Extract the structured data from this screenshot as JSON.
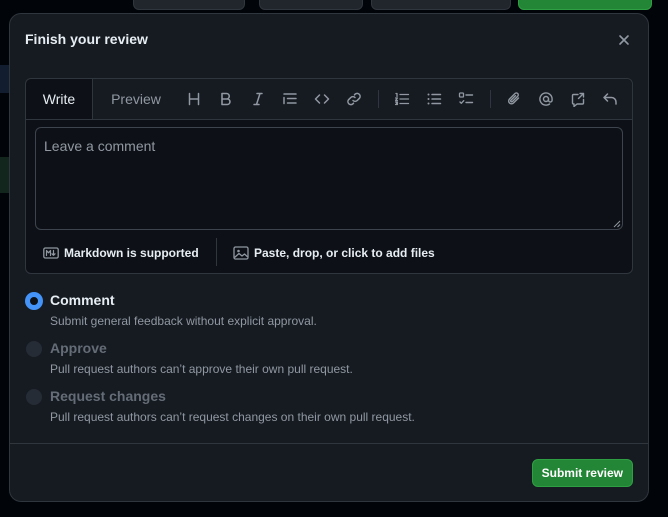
{
  "dialog": {
    "title": "Finish your review"
  },
  "editor": {
    "tabs": [
      {
        "label": "Write",
        "active": true
      },
      {
        "label": "Preview",
        "active": false
      }
    ],
    "toolbar_icons": [
      "heading-icon",
      "bold-icon",
      "italic-icon",
      "quote-icon",
      "code-icon",
      "link-icon",
      "numbered-list-icon",
      "unordered-list-icon",
      "task-list-icon",
      "attach-icon",
      "mention-icon",
      "reference-icon",
      "undo-icon"
    ],
    "comment": {
      "value": "",
      "placeholder": "Leave a comment"
    },
    "footer": {
      "markdown_label": "Markdown is supported",
      "files_label": "Paste, drop, or click to add files"
    }
  },
  "review_options": [
    {
      "label": "Comment",
      "description": "Submit general feedback without explicit approval.",
      "checked": true,
      "disabled": false
    },
    {
      "label": "Approve",
      "description": "Pull request authors can’t approve their own pull request.",
      "checked": false,
      "disabled": true
    },
    {
      "label": "Request changes",
      "description": "Pull request authors can’t request changes on their own pull request.",
      "checked": false,
      "disabled": true
    }
  ],
  "actions": {
    "submit_label": "Submit review"
  },
  "colors": {
    "accent": "#4493f8",
    "primary_button": "#238636",
    "dialog_bg": "#161b22",
    "border": "#30363d"
  }
}
